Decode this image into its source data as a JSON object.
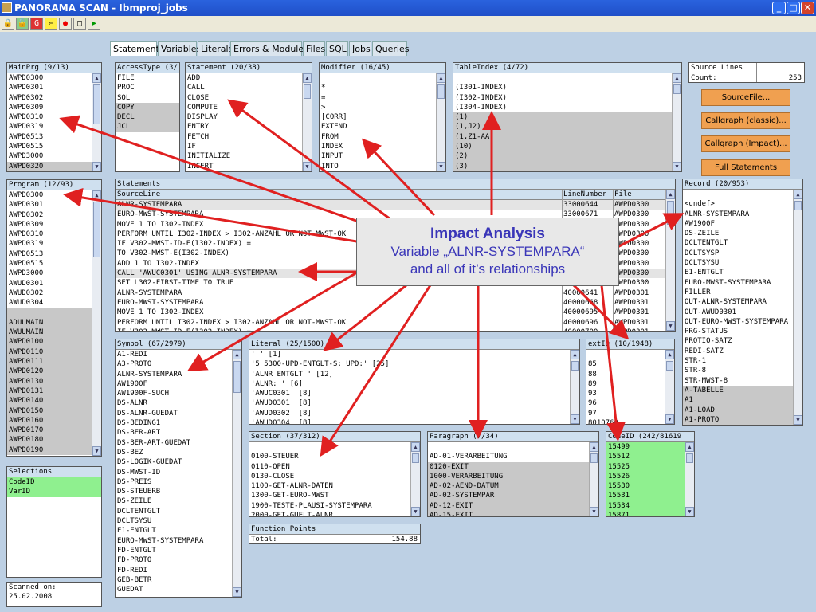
{
  "window": {
    "title": "PANORAMA SCAN - Ibmproj_jobs"
  },
  "tabs": [
    "Statements",
    "Variables",
    "Literals",
    "Errors & Modules",
    "Files",
    "SQL",
    "Jobs",
    "Queries"
  ],
  "mainprg": {
    "header": "MainPrg (9/13)",
    "items": [
      "AWPD0300",
      "AWPD0301",
      "AWPD0302",
      "AWPD0309",
      "AWPD0310",
      "AWPD0319",
      "AWPD0513",
      "AWPD0515",
      "AWPD3000",
      "AWPD0320"
    ]
  },
  "program": {
    "header": "Program (12/93)",
    "items": [
      "AWPD0300",
      "AWPD0301",
      "AWPD0302",
      "AWPD0309",
      "AWPD0310",
      "AWPD0319",
      "AWPD0513",
      "AWPD0515",
      "AWPD3000",
      "AWUD0301",
      "AWUD0302",
      "AWUD0304",
      "",
      "ADUUMAIN",
      "AWUUMAIN",
      "AWPD0100",
      "AWPD0110",
      "AWPD0111",
      "AWPD0120",
      "AWPD0130",
      "AWPD0131",
      "AWPD0140",
      "AWPD0150",
      "AWPD0160",
      "AWPD0170",
      "AWPD0180",
      "AWPD0190"
    ]
  },
  "selections": {
    "header": "Selections",
    "items": [
      "CodeID",
      "VarID"
    ]
  },
  "scanned": {
    "label": "Scanned on:",
    "date": "25.02.2008"
  },
  "accesstype": {
    "header": "AccessType (3/",
    "items": [
      "FILE",
      "PROC",
      "SQL",
      "COPY",
      "DECL",
      "JCL"
    ]
  },
  "statement": {
    "header": "Statement (20/38)",
    "items": [
      "ADD",
      "CALL",
      "CLOSE",
      "COMPUTE",
      "DISPLAY",
      "ENTRY",
      "FETCH",
      "IF",
      "INITIALIZE",
      "INSERT"
    ]
  },
  "modifier": {
    "header": "Modifier (16/45)",
    "items": [
      "",
      "*",
      "=",
      ">",
      "[CORR]",
      "EXTEND",
      "FROM",
      "INDEX",
      "INPUT",
      "INTO"
    ]
  },
  "tableindex": {
    "header": "TableIndex (4/72)",
    "items": [
      "",
      "(I301-INDEX)",
      "(I302-INDEX)",
      "(I304-INDEX)",
      "(1)",
      "(1,J2)",
      "(1,Z1-AA",
      "(10)",
      "(2)",
      "(3)"
    ]
  },
  "sourcelines": {
    "header": "Source Lines",
    "count_label": "Count:",
    "count": "253"
  },
  "buttons": {
    "sourcefile": "SourceFile...",
    "callgraph_classic": "Callgraph (classic)...",
    "callgraph_impact": "Callgraph (Impact)...",
    "full_statements": "Full Statements"
  },
  "statements": {
    "caption": "Statements",
    "col_source": "SourceLine",
    "col_line": "LineNumber",
    "col_file": "File",
    "rows": [
      {
        "src": "ALNR-SYSTEMPARA",
        "line": "33000644",
        "file": "AWPD0300"
      },
      {
        "src": "EURO-MWST-SYSTEMPARA",
        "line": "33000671",
        "file": "AWPD0300"
      },
      {
        "src": "MOVE 1 TO I302-INDEX",
        "line": "",
        "file": "AWPD0300"
      },
      {
        "src": "PERFORM UNTIL I302-INDEX > I302-ANZAHL OR NOT-MWST-OK",
        "line": "",
        "file": "AWPD0300"
      },
      {
        "src": "IF V302-MWST-ID-E(I302-INDEX) =",
        "line": "",
        "file": "AWPD0300"
      },
      {
        "src": "TO V302-MWST-E(I302-INDEX)",
        "line": "",
        "file": "AWPD0300"
      },
      {
        "src": "ADD 1 TO I302-INDEX",
        "line": "",
        "file": "AWPD0300"
      },
      {
        "src": "CALL 'AWUC0301' USING ALNR-SYSTEMPARA",
        "line": "",
        "file": "AWPD0300"
      },
      {
        "src": "SET L302-FIRST-TIME TO TRUE",
        "line": "",
        "file": "AWPD0300"
      },
      {
        "src": "ALNR-SYSTEMPARA",
        "line": "40000641",
        "file": "AWPD0301"
      },
      {
        "src": "EURO-MWST-SYSTEMPARA",
        "line": "40000668",
        "file": "AWPD0301"
      },
      {
        "src": "MOVE 1 TO I302-INDEX",
        "line": "40000695",
        "file": "AWPD0301"
      },
      {
        "src": "PERFORM UNTIL I302-INDEX > I302-ANZAHL OR NOT-MWST-OK",
        "line": "40000696",
        "file": "AWPD0301"
      },
      {
        "src": "IF V302-MWST-ID-E(I302-INDEX) =",
        "line": "40000700",
        "file": "AWPD0301"
      }
    ]
  },
  "record": {
    "header": "Record (20/953)",
    "items": [
      "",
      "<undef>",
      "ALNR-SYSTEMPARA",
      "AW1900F",
      "DS-ZEILE",
      "DCLTENTGLT",
      "DCLTSYSP",
      "DCLTSYSU",
      "E1-ENTGLT",
      "EURO-MWST-SYSTEMPARA",
      "FILLER",
      "OUT-ALNR-SYSTEMPARA",
      "OUT-AWUD0301",
      "OUT-EURO-MWST-SYSTEMPARA",
      "PRG-STATUS",
      "PROTIO-SATZ",
      "REDI-SATZ",
      "STR-1",
      "STR-8",
      "STR-MWST-8",
      "A-TABELLE",
      "A1",
      "A1-LOAD",
      "A1-PROTO"
    ]
  },
  "symbol": {
    "header": "Symbol (67/2979)",
    "items": [
      "A1-REDI",
      "A3-PROTO",
      "ALNR-SYSTEMPARA",
      "AW1900F",
      "AW1900F-SUCH",
      "DS-ALNR",
      "DS-ALNR-GUEDAT",
      "DS-BEDING1",
      "DS-BER-ART",
      "DS-BER-ART-GUEDAT",
      "DS-BEZ",
      "DS-LOGIK-GUEDAT",
      "DS-MWST-ID",
      "DS-PREIS",
      "DS-STEUERB",
      "DS-ZEILE",
      "DCLTENTGLT",
      "DCLTSYSU",
      "E1-ENTGLT",
      "EURO-MWST-SYSTEMPARA",
      "FD-ENTGLT",
      "FD-PROTO",
      "FD-REDI",
      "GEB-BETR",
      "GUEDAT"
    ]
  },
  "literal": {
    "header": "Literal (25/1500)",
    "items": [
      "' ' [1]",
      "'5 5300-UPD-ENTGLT-S: UPD:' [25]",
      "'ALNR ENTGLT ' [12]",
      "'ALNR: ' [6]",
      "'AWUC0301' [8]",
      "'AWUD0301' [8]",
      "'AWUD0302' [8]",
      "'AWUD0304' [8]"
    ]
  },
  "extid": {
    "header": "extID (10/1948)",
    "items": [
      "",
      "85",
      "88",
      "89",
      "93",
      "96",
      "97",
      "8010760"
    ]
  },
  "section": {
    "header": "Section (37/312)",
    "items": [
      "",
      "0100-STEUER",
      "0110-OPEN",
      "0130-CLOSE",
      "1100-GET-ALNR-DATEN",
      "1300-GET-EURO-MWST",
      "1900-TESTE-PLAUSI-SYSTEMPARA",
      "2000-GET-GUELT-ALNR"
    ]
  },
  "paragraph": {
    "header": "Paragraph (7/34)",
    "items": [
      "",
      "AD-01-VERARBEITUNG",
      "0120-EXIT",
      "1000-VERARBEITUNG",
      "AD-02-AEND-DATUM",
      "AD-02-SYSTEMPAR",
      "AD-12-EXIT",
      "AD-15-EXIT"
    ]
  },
  "codeid": {
    "header": "CodeID (242/81619",
    "items": [
      "15499",
      "15512",
      "15525",
      "15526",
      "15530",
      "15531",
      "15534",
      "15871"
    ]
  },
  "functionpoints": {
    "header": "Function Points",
    "label": "Total:",
    "value": "154.88"
  },
  "callout": {
    "title": "Impact Analysis",
    "line1": "Variable „ALNR-SYSTEMPARA“",
    "line2": "and all of it’s relationships"
  },
  "colors": {
    "accent_arrow": "#e02020",
    "highlight_green": "#8ff08f",
    "orange_button": "#f0a050"
  }
}
